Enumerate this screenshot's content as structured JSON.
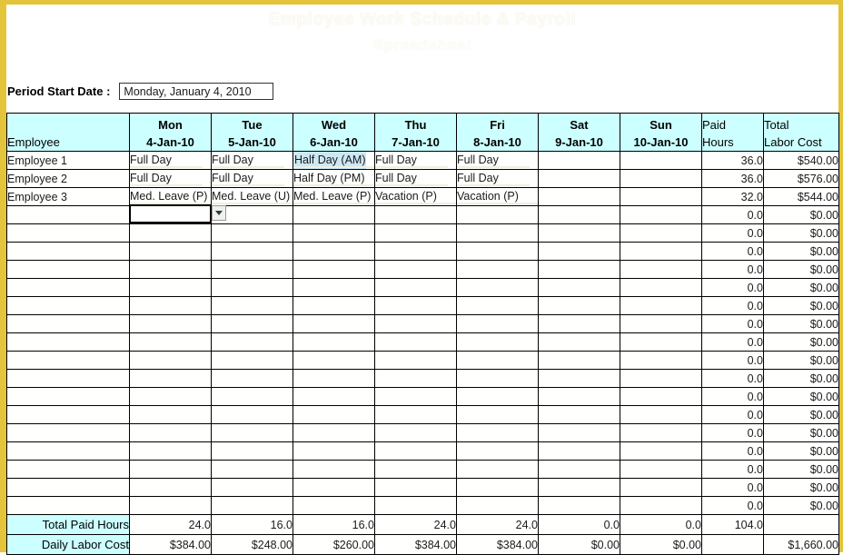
{
  "title": {
    "line1": "Employee Work Schedule & Payroll",
    "line2": "Spreadsheet"
  },
  "period": {
    "label": "Period Start Date :",
    "value": "Monday, January 4, 2010",
    "placeholder": "Monday, January 4, 2010"
  },
  "colors": {
    "frame": "#e3c43a",
    "header_fill": "#ccffff",
    "highlight_fill": "#cde8f5",
    "grid_line": "#000000"
  },
  "table": {
    "headers": {
      "employee": "Employee",
      "days": [
        {
          "dow": "Mon",
          "date": "4-Jan-10"
        },
        {
          "dow": "Tue",
          "date": "5-Jan-10"
        },
        {
          "dow": "Wed",
          "date": "6-Jan-10"
        },
        {
          "dow": "Thu",
          "date": "7-Jan-10"
        },
        {
          "dow": "Fri",
          "date": "8-Jan-10"
        },
        {
          "dow": "Sat",
          "date": "9-Jan-10"
        },
        {
          "dow": "Sun",
          "date": "10-Jan-10"
        }
      ],
      "paid_hours_l1": "Paid",
      "paid_hours_l2": "Hours",
      "labor_cost_l1": "Total",
      "labor_cost_l2": "Labor Cost"
    },
    "rows": [
      {
        "employee": "Employee 1",
        "days": [
          "Full Day",
          "Full Day",
          "Half Day (AM)",
          "Full Day",
          "Full Day",
          "",
          ""
        ],
        "paid_hours": "36.0",
        "labor_cost": "$540.00"
      },
      {
        "employee": "Employee 2",
        "days": [
          "Full Day",
          "Full Day",
          "Half Day (PM)",
          "Full Day",
          "Full Day",
          "",
          ""
        ],
        "paid_hours": "36.0",
        "labor_cost": "$576.00"
      },
      {
        "employee": "Employee 3",
        "days": [
          "Med. Leave (P)",
          "Med. Leave (U)",
          "Med. Leave (P)",
          "Vacation (P)",
          "Vacation (P)",
          "",
          ""
        ],
        "paid_hours": "32.0",
        "labor_cost": "$544.00"
      },
      {
        "employee": "",
        "days": [
          "",
          "",
          "",
          "",
          "",
          "",
          ""
        ],
        "paid_hours": "0.0",
        "labor_cost": "$0.00"
      },
      {
        "employee": "",
        "days": [
          "",
          "",
          "",
          "",
          "",
          "",
          ""
        ],
        "paid_hours": "0.0",
        "labor_cost": "$0.00"
      },
      {
        "employee": "",
        "days": [
          "",
          "",
          "",
          "",
          "",
          "",
          ""
        ],
        "paid_hours": "0.0",
        "labor_cost": "$0.00"
      },
      {
        "employee": "",
        "days": [
          "",
          "",
          "",
          "",
          "",
          "",
          ""
        ],
        "paid_hours": "0.0",
        "labor_cost": "$0.00"
      },
      {
        "employee": "",
        "days": [
          "",
          "",
          "",
          "",
          "",
          "",
          ""
        ],
        "paid_hours": "0.0",
        "labor_cost": "$0.00"
      },
      {
        "employee": "",
        "days": [
          "",
          "",
          "",
          "",
          "",
          "",
          ""
        ],
        "paid_hours": "0.0",
        "labor_cost": "$0.00"
      },
      {
        "employee": "",
        "days": [
          "",
          "",
          "",
          "",
          "",
          "",
          ""
        ],
        "paid_hours": "0.0",
        "labor_cost": "$0.00"
      },
      {
        "employee": "",
        "days": [
          "",
          "",
          "",
          "",
          "",
          "",
          ""
        ],
        "paid_hours": "0.0",
        "labor_cost": "$0.00"
      },
      {
        "employee": "",
        "days": [
          "",
          "",
          "",
          "",
          "",
          "",
          ""
        ],
        "paid_hours": "0.0",
        "labor_cost": "$0.00"
      },
      {
        "employee": "",
        "days": [
          "",
          "",
          "",
          "",
          "",
          "",
          ""
        ],
        "paid_hours": "0.0",
        "labor_cost": "$0.00"
      },
      {
        "employee": "",
        "days": [
          "",
          "",
          "",
          "",
          "",
          "",
          ""
        ],
        "paid_hours": "0.0",
        "labor_cost": "$0.00"
      },
      {
        "employee": "",
        "days": [
          "",
          "",
          "",
          "",
          "",
          "",
          ""
        ],
        "paid_hours": "0.0",
        "labor_cost": "$0.00"
      },
      {
        "employee": "",
        "days": [
          "",
          "",
          "",
          "",
          "",
          "",
          ""
        ],
        "paid_hours": "0.0",
        "labor_cost": "$0.00"
      },
      {
        "employee": "",
        "days": [
          "",
          "",
          "",
          "",
          "",
          "",
          ""
        ],
        "paid_hours": "0.0",
        "labor_cost": "$0.00"
      },
      {
        "employee": "",
        "days": [
          "",
          "",
          "",
          "",
          "",
          "",
          ""
        ],
        "paid_hours": "0.0",
        "labor_cost": "$0.00"
      },
      {
        "employee": "",
        "days": [
          "",
          "",
          "",
          "",
          "",
          "",
          ""
        ],
        "paid_hours": "0.0",
        "labor_cost": "$0.00"
      },
      {
        "employee": "",
        "days": [
          "",
          "",
          "",
          "",
          "",
          "",
          ""
        ],
        "paid_hours": "0.0",
        "labor_cost": "$0.00"
      }
    ],
    "totals": {
      "hours_label": "Total Paid Hours",
      "hours_days": [
        "24.0",
        "16.0",
        "16.0",
        "24.0",
        "24.0",
        "0.0",
        "0.0"
      ],
      "hours_total": "104.0",
      "hours_cost_blank": "",
      "cost_label": "Daily Labor Cost",
      "cost_days": [
        "$384.00",
        "$248.00",
        "$260.00",
        "$384.00",
        "$384.00",
        "$0.00",
        "$0.00"
      ],
      "cost_hours_blank": "",
      "cost_total": "$1,660.00"
    }
  },
  "active_cell": {
    "value": "",
    "dropdown_icon": "chevron-down-icon"
  }
}
